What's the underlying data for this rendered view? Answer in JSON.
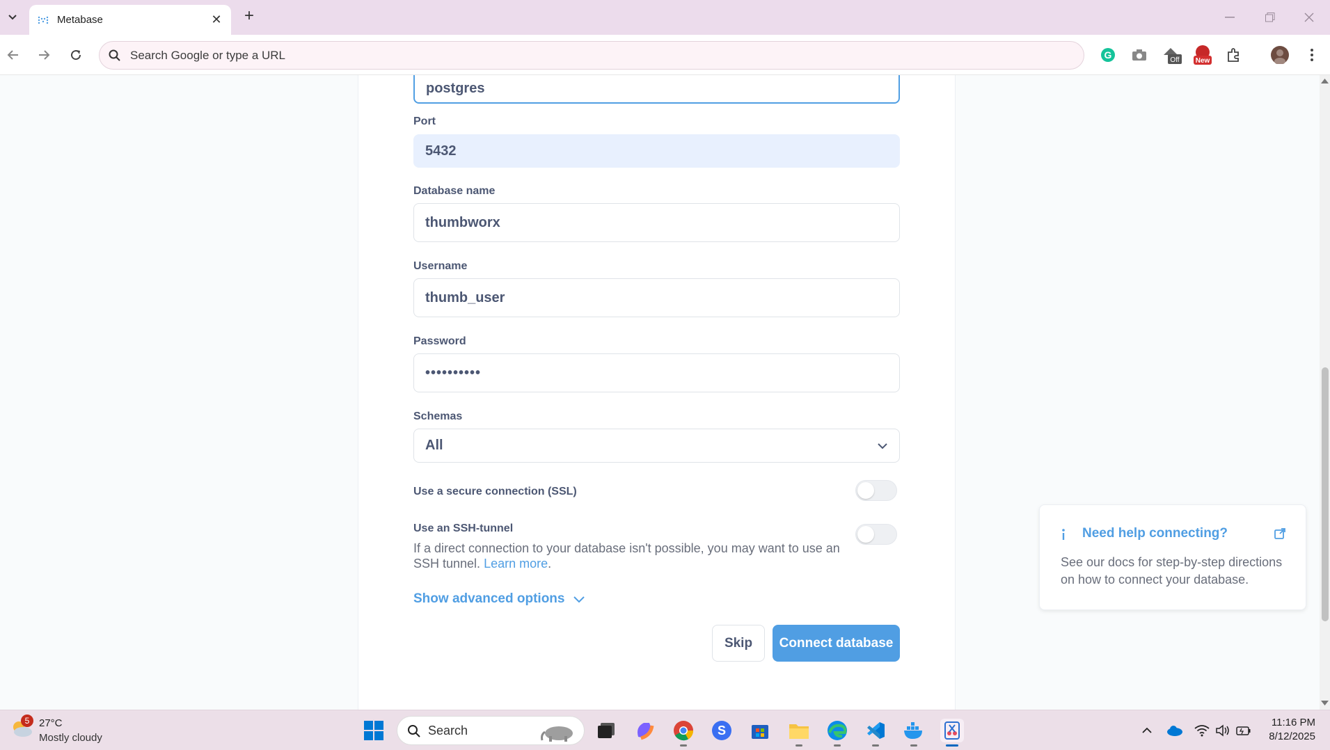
{
  "browser": {
    "tab_title": "Metabase",
    "omnibox_placeholder": "Search Google or type a URL",
    "extension_badges": {
      "off": "Off",
      "new": "New"
    }
  },
  "form": {
    "host_value": "postgres",
    "port": {
      "label": "Port",
      "value": "5432"
    },
    "database_name": {
      "label": "Database name",
      "value": "thumbworx"
    },
    "username": {
      "label": "Username",
      "value": "thumb_user"
    },
    "password": {
      "label": "Password",
      "value": "••••••••••"
    },
    "schemas": {
      "label": "Schemas",
      "value": "All"
    },
    "ssl": {
      "label": "Use a secure connection (SSL)",
      "enabled": false
    },
    "ssh": {
      "label": "Use an SSH-tunnel",
      "description": "If a direct connection to your database isn't possible, you may want to use an SSH tunnel.",
      "learn_more": "Learn more",
      "enabled": false
    },
    "advanced": "Show advanced options",
    "skip_button": "Skip",
    "connect_button": "Connect database"
  },
  "help_card": {
    "title": "Need help connecting?",
    "body": "See our docs for step-by-step directions on how to connect your database."
  },
  "taskbar": {
    "weather_temp": "27°C",
    "weather_desc": "Mostly cloudy",
    "weather_badge": "5",
    "search_label": "Search",
    "time": "11:16 PM",
    "date": "8/12/2025"
  },
  "colors": {
    "brand": "#509ee3",
    "text": "#4c5773",
    "muted": "#696e7b"
  }
}
